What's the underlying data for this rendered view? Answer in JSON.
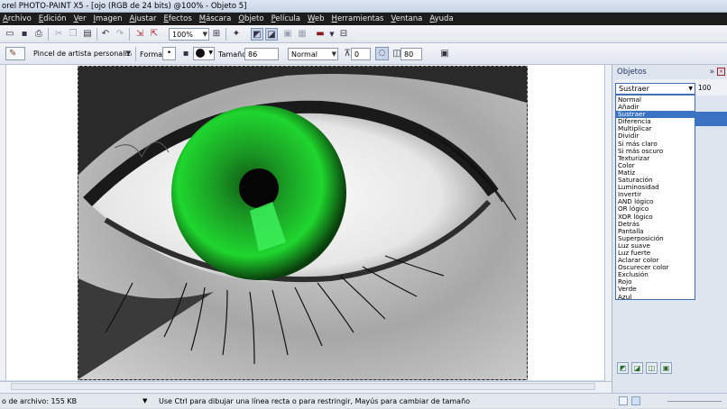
{
  "window": {
    "title": "orel PHOTO-PAINT X5 - [ojo (RGB de 24 bits) @100% - Objeto 5]"
  },
  "menu": [
    "Archivo",
    "Edición",
    "Ver",
    "Imagen",
    "Ajustar",
    "Efectos",
    "Máscara",
    "Objeto",
    "Película",
    "Web",
    "Herramientas",
    "Ventana",
    "Ayuda"
  ],
  "toolbar": {
    "zoom": "100%"
  },
  "property_bar": {
    "brush_name": "Pincel de artista personalizado",
    "shape_label": "Forma",
    "size_label": "Tamaño",
    "size_value": "86",
    "merge_mode": "Normal",
    "transparency_value": "0",
    "opacity_value": "80"
  },
  "docker": {
    "title": "Objetos",
    "blend_mode": "Sustraer",
    "opacity": "100",
    "blend_options": [
      "Normal",
      "Añadir",
      "Sustraer",
      "Diferencia",
      "Multiplicar",
      "Dividir",
      "Si más claro",
      "Si más oscuro",
      "Texturizar",
      "Color",
      "Matiz",
      "Saturación",
      "Luminosidad",
      "Invertir",
      "AND lógico",
      "OR lógico",
      "XOR lógico",
      "Detrás",
      "Pantalla",
      "Superposición",
      "Luz suave",
      "Luz fuerte",
      "Aclarar color",
      "Oscurecer color",
      "Exclusión",
      "Rojo",
      "Verde",
      "Azul"
    ],
    "selected_index": 2
  },
  "status": {
    "file_size": "o de archivo: 155 KB",
    "hint": "Use Ctrl para dibujar una línea recta o para restringir, Mayús para cambiar de tamaño"
  },
  "colors": {
    "accent": "#3a73c4",
    "menu_bg": "#1d1d1d",
    "iris": "#1fd62e"
  }
}
